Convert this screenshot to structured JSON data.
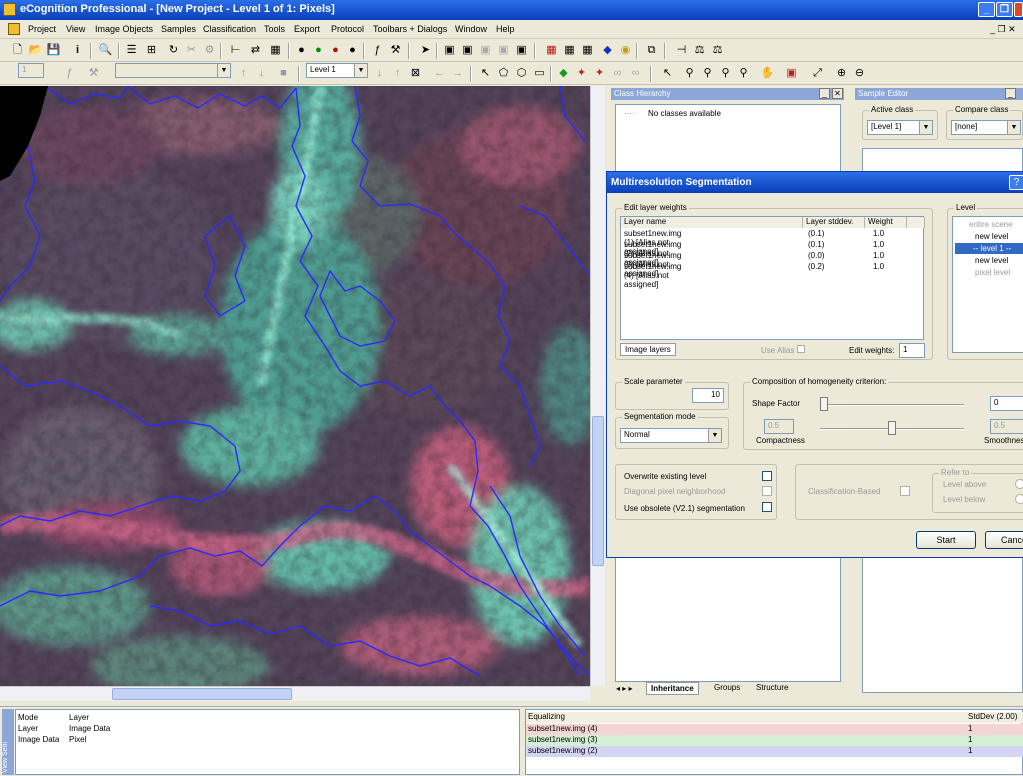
{
  "window": {
    "title": "eCognition Professional - [New Project - Level 1 of 1: Pixels]"
  },
  "menu": [
    "Project",
    "View",
    "Image Objects",
    "Samples",
    "Classification",
    "Tools",
    "Export",
    "Protocol",
    "Toolbars + Dialogs",
    "Window",
    "Help"
  ],
  "toolbar2": {
    "level_select": "Level 1",
    "zoom_value": "1"
  },
  "class_hierarchy": {
    "title": "Class Hierarchy",
    "empty_text": "No classes available",
    "tabs": [
      "Inheritance",
      "Groups",
      "Structure"
    ]
  },
  "sample_editor": {
    "title": "Sample Editor",
    "active_class_label": "Active class",
    "active_class_value": "[Level 1]",
    "compare_class_label": "Compare class",
    "compare_class_value": "[none]"
  },
  "dialog": {
    "title": "Multiresolution Segmentation",
    "edit_layer_weights_label": "Edit layer weights",
    "columns": [
      "Layer name",
      "Layer stddev.",
      "Weight"
    ],
    "layers": [
      {
        "name": "subset1new.img (1) [Alias not assigned]",
        "stddev": "(0.1)",
        "weight": "1.0"
      },
      {
        "name": "subset1new.img (2) [Alias not assigned]",
        "stddev": "(0.1)",
        "weight": "1.0"
      },
      {
        "name": "subset1new.img (3) [Alias not assigned]",
        "stddev": "(0.0)",
        "weight": "1.0"
      },
      {
        "name": "subset1new.img (4) [Alias not assigned]",
        "stddev": "(0.2)",
        "weight": "1.0"
      }
    ],
    "image_layers_tab": "Image layers",
    "use_alias_label": "Use Alias",
    "edit_weights_label": "Edit weights:",
    "edit_weights_value": "1",
    "level_label": "Level",
    "level_items": [
      "entire scene",
      "new level",
      "-- level 1 --",
      "new level",
      "pixel level"
    ],
    "scale_parameter_label": "Scale parameter",
    "scale_parameter_value": "10",
    "segmentation_mode_label": "Segmentation mode",
    "segmentation_mode_value": "Normal",
    "composition_label": "Composition of homogeneity criterion:",
    "shape_factor_label": "Shape Factor",
    "shape_factor_value": "0",
    "compactness_label": "Compactness",
    "compactness_value": "0.5",
    "smoothness_label": "Smoothnes",
    "smoothness_value": "0.5",
    "overwrite_label": "Overwrite existing level",
    "diagonal_label": "Diagonal pixel neighborhood",
    "obsolete_label": "Use obsolete (V2.1) segmentation",
    "classification_based_label": "Classification-Based",
    "refer_to_label": "Refer to",
    "level_above_label": "Level above",
    "level_below_label": "Level below",
    "start_button": "Start",
    "cancel_button": "Cancel"
  },
  "view_settings": {
    "side_label": "View Setti",
    "rows": [
      {
        "key": "Mode",
        "value": "Layer"
      },
      {
        "key": "Layer",
        "value": "Image Data"
      },
      {
        "key": "Image Data",
        "value": "Pixel"
      }
    ]
  },
  "equalizing": {
    "title": "Equalizing",
    "col2": "StdDev (2.00)",
    "rows": [
      {
        "name": "subset1new.img (4)",
        "value": "1",
        "color": "#f4d4d4"
      },
      {
        "name": "subset1new.img (3)",
        "value": "1",
        "color": "#d4f0d4"
      },
      {
        "name": "subset1new.img (2)",
        "value": "1",
        "color": "#d4d4f4"
      }
    ]
  }
}
